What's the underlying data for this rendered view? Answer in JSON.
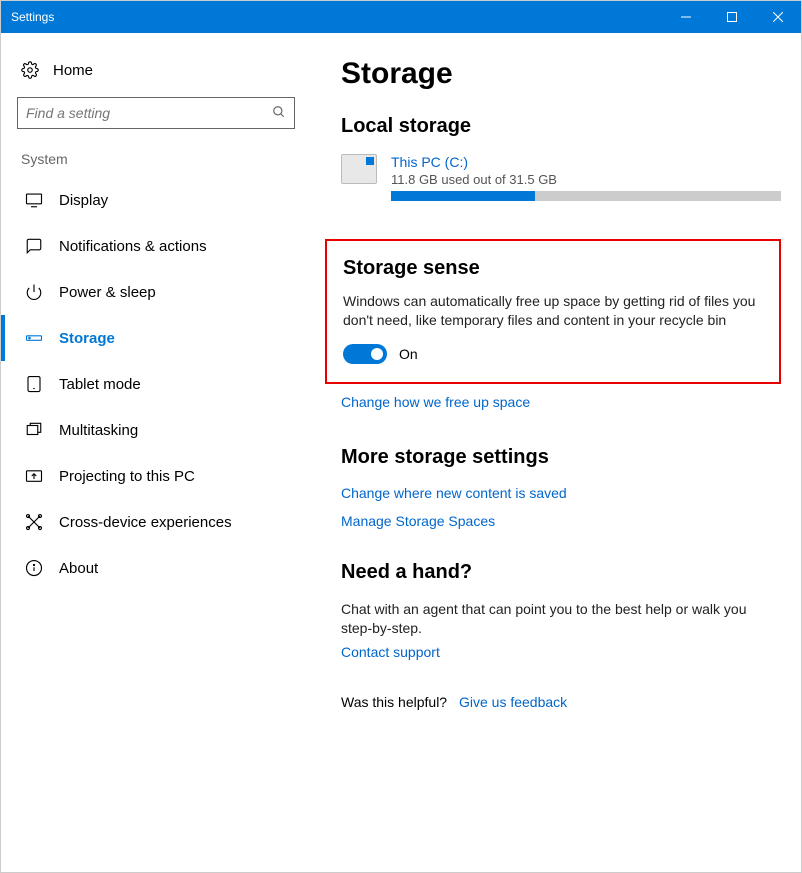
{
  "window": {
    "title": "Settings"
  },
  "sidebar": {
    "home_label": "Home",
    "search_placeholder": "Find a setting",
    "category_label": "System",
    "items": [
      {
        "label": "Display",
        "active": false
      },
      {
        "label": "Notifications & actions",
        "active": false
      },
      {
        "label": "Power & sleep",
        "active": false
      },
      {
        "label": "Storage",
        "active": true
      },
      {
        "label": "Tablet mode",
        "active": false
      },
      {
        "label": "Multitasking",
        "active": false
      },
      {
        "label": "Projecting to this PC",
        "active": false
      },
      {
        "label": "Cross-device experiences",
        "active": false
      },
      {
        "label": "About",
        "active": false
      }
    ]
  },
  "main": {
    "page_title": "Storage",
    "local_storage_title": "Local storage",
    "disk": {
      "name": "This PC (C:)",
      "usage_text": "11.8 GB used out of 31.5 GB",
      "used_percent": 37
    },
    "storage_sense": {
      "title": "Storage sense",
      "description": "Windows can automatically free up space by getting rid of files you don't need, like temporary files and content in your recycle bin",
      "toggle_state": "On",
      "change_link": "Change how we free up space"
    },
    "more_settings": {
      "title": "More storage settings",
      "links": [
        "Change where new content is saved",
        "Manage Storage Spaces"
      ]
    },
    "help": {
      "title": "Need a hand?",
      "description": "Chat with an agent that can point you to the best help or walk you step-by-step.",
      "contact_link": "Contact support"
    },
    "feedback": {
      "prompt": "Was this helpful?",
      "link": "Give us feedback"
    }
  }
}
